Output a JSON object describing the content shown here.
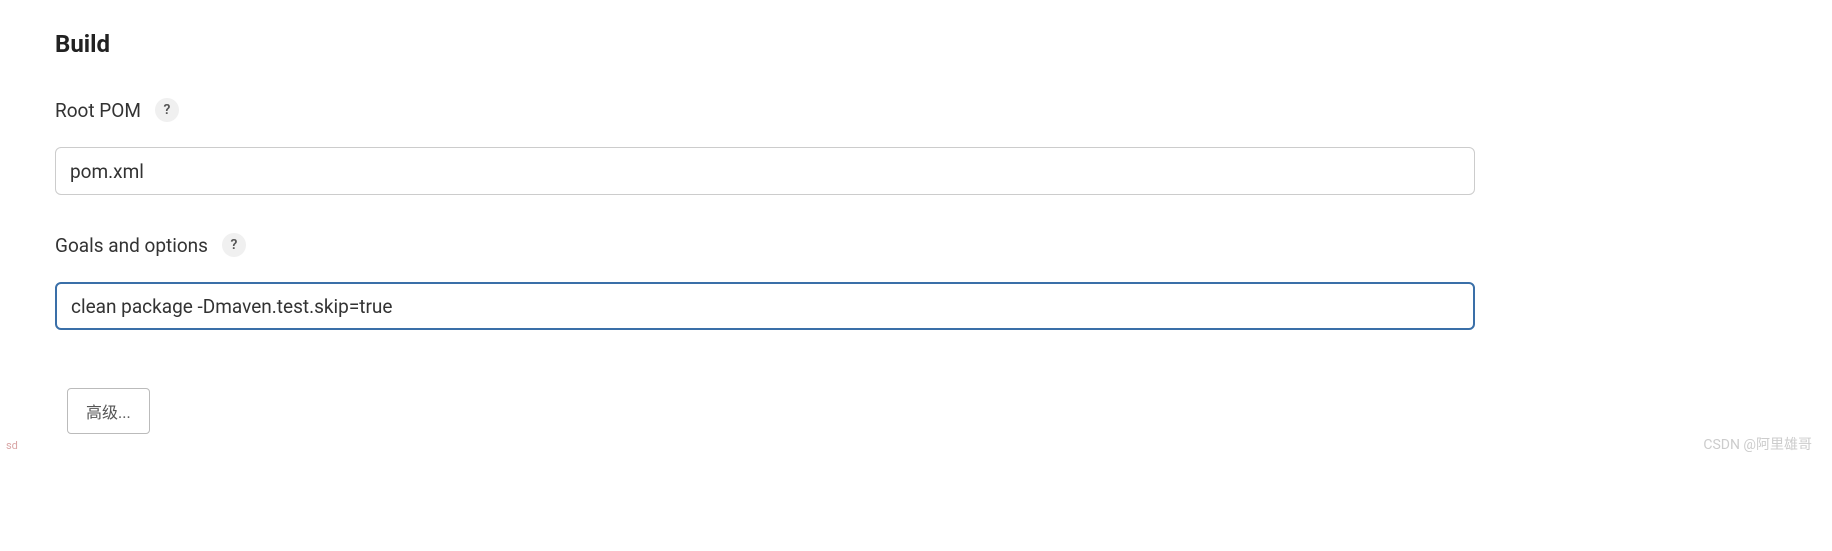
{
  "section": {
    "title": "Build"
  },
  "fields": {
    "rootPom": {
      "label": "Root POM",
      "helpText": "?",
      "value": "pom.xml"
    },
    "goalsOptions": {
      "label": "Goals and options",
      "helpText": "?",
      "value": "clean package -Dmaven.test.skip=true"
    }
  },
  "buttons": {
    "advanced": "高级..."
  },
  "watermark": "CSDN @阿里雄哥",
  "sidemark": "sd"
}
